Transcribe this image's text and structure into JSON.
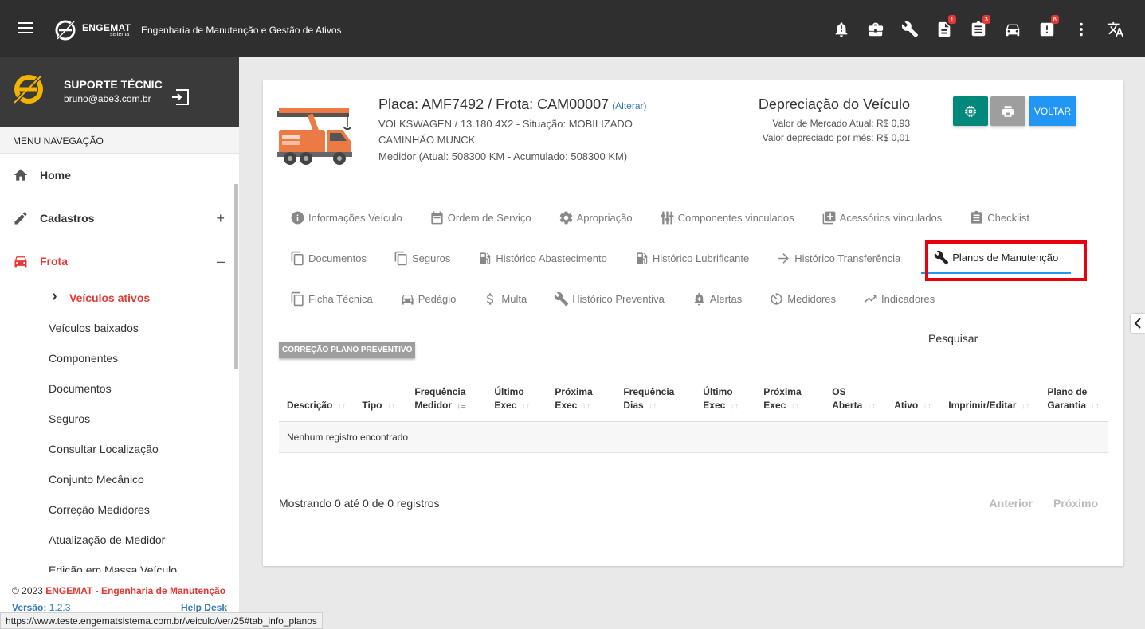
{
  "topbar": {
    "logo_name": "ENGEMAT",
    "logo_sub": "sistema",
    "app_title": "Engenharia de Manutenção e Gestão de Ativos",
    "icons": [
      {
        "name": "bell-alert-icon",
        "badge": ""
      },
      {
        "name": "briefcase-icon",
        "badge": ""
      },
      {
        "name": "wrench-icon",
        "badge": ""
      },
      {
        "name": "document-icon",
        "badge": "1"
      },
      {
        "name": "document-stack-icon",
        "badge": "3"
      },
      {
        "name": "car-icon",
        "badge": ""
      },
      {
        "name": "alert-document-icon",
        "badge": "8"
      },
      {
        "name": "more-vert-icon",
        "badge": ""
      },
      {
        "name": "translate-icon",
        "badge": ""
      }
    ]
  },
  "sidebar": {
    "user_name": "SUPORTE TÉCNIC",
    "user_email": "bruno@abe3.com.br",
    "menu_title": "MENU NAVEGAÇÃO",
    "items": [
      {
        "label": "Home",
        "toggle": ""
      },
      {
        "label": "Cadastros",
        "toggle": "+"
      },
      {
        "label": "Frota",
        "toggle": "–"
      }
    ],
    "sub_items": [
      "Veículos ativos",
      "Veículos baixados",
      "Componentes",
      "Documentos",
      "Seguros",
      "Consultar Localização",
      "Conjunto Mecânico",
      "Correção Medidores",
      "Atualização de Medidor",
      "Edição em Massa Veículo"
    ],
    "footer": {
      "copyright": "© 2023 ",
      "company": "ENGEMAT - Engenharia de Manutenção",
      "version_label": "Versão:",
      "version": "1.2.3",
      "help": "Help Desk"
    }
  },
  "vehicle": {
    "plate_title": "Placa: AMF7492 / Frota: CAM00007",
    "alter_link": "(Alterar)",
    "line1": "VOLKSWAGEN / 13.180 4X2 - Situação: MOBILIZADO",
    "line2": "CAMINHÃO MUNCK",
    "line3": "Medidor (Atual: 508300 KM - Acumulado: 508300 KM)"
  },
  "depreciation": {
    "title": "Depreciação do Veículo",
    "market": "Valor de Mercado Atual: R$ 0,93",
    "monthly": "Valor depreciado por mês: R$ 0,01"
  },
  "buttons": {
    "voltar": "VOLTAR",
    "colors": {
      "teal": "#00897b",
      "gray": "#9e9e9e",
      "blue": "#2196f3"
    }
  },
  "tabs": [
    [
      "Informações Veículo",
      "Ordem de Serviço",
      "Apropriação",
      "Componentes vinculados",
      "Acessórios vinculados",
      "Checklist"
    ],
    [
      "Documentos",
      "Seguros",
      "Histórico Abastecimento",
      "Histórico Lubrificante",
      "Histórico Transferência",
      "Planos de Manutenção"
    ],
    [
      "Ficha Técnica",
      "Pedágio",
      "Multa",
      "Histórico Preventiva",
      "Alertas",
      "Medidores",
      "Indicadores"
    ]
  ],
  "active_tab": "Planos de Manutenção",
  "table_section": {
    "correction_button": "CORREÇÃO PLANO PREVENTIVO",
    "search_label": "Pesquisar",
    "headers": [
      "Descrição",
      "Tipo",
      "Frequência Medidor",
      "Último Exec",
      "Próxima Exec",
      "Frequência Dias",
      "Último Exec",
      "Próxima Exec",
      "OS Aberta",
      "Ativo",
      "Imprimir/Editar",
      "Plano de Garantia"
    ],
    "empty_message": "Nenhum registro encontrado",
    "showing": "Mostrando 0 até 0 de 0 registros",
    "prev": "Anterior",
    "next": "Próximo"
  },
  "status_url": "https://www.teste.engematsistema.com.br/veiculo/ver/25#tab_info_planos"
}
